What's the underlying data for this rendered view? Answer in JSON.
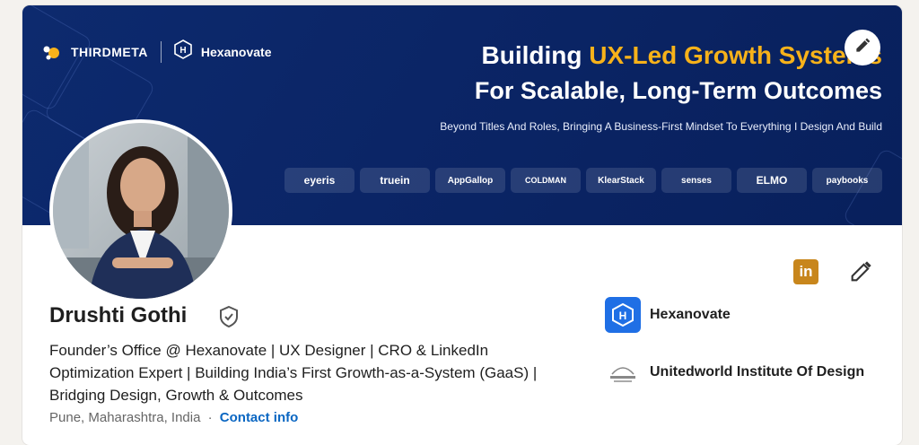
{
  "banner": {
    "brand_1": "THIRDMETA",
    "brand_2": "Hexanovate",
    "headline_1_start": "Building ",
    "headline_1_accent": "UX-Led Growth Systems",
    "headline_2": "For Scalable, Long-Term Outcomes",
    "tagline": "Beyond Titles And Roles, Bringing A Business-First Mindset To Everything I Design And Build",
    "client_logos": [
      "eyeris",
      "truein",
      "AppGallop",
      "COLDMAN",
      "KlearStack",
      "senses",
      "ELMO",
      "paybooks"
    ]
  },
  "profile": {
    "name": "Drushti Gothi",
    "headline": "Founder’s Office @ Hexanovate | UX Designer | CRO & LinkedIn Optimization Expert | Building India’s First Growth-as-a-System (GaaS) | Bridging Design, Growth & Outcomes",
    "location": "Pune, Maharashtra, India",
    "separator": "·",
    "contact_label": "Contact info"
  },
  "organizations": [
    {
      "name": "Hexanovate",
      "icon": "hexanovate-logo"
    },
    {
      "name": "Unitedworld Institute Of Design",
      "icon": "unitedworld-logo"
    }
  ],
  "icons": {
    "linkedin_badge_text": "in",
    "edit": "pencil-icon"
  },
  "colors": {
    "banner": "#0b2566",
    "accent": "#f7b21a",
    "link": "#0a66c2",
    "linkedin_badge": "#c8861c",
    "hexanovate_badge": "#1f6fe5"
  }
}
